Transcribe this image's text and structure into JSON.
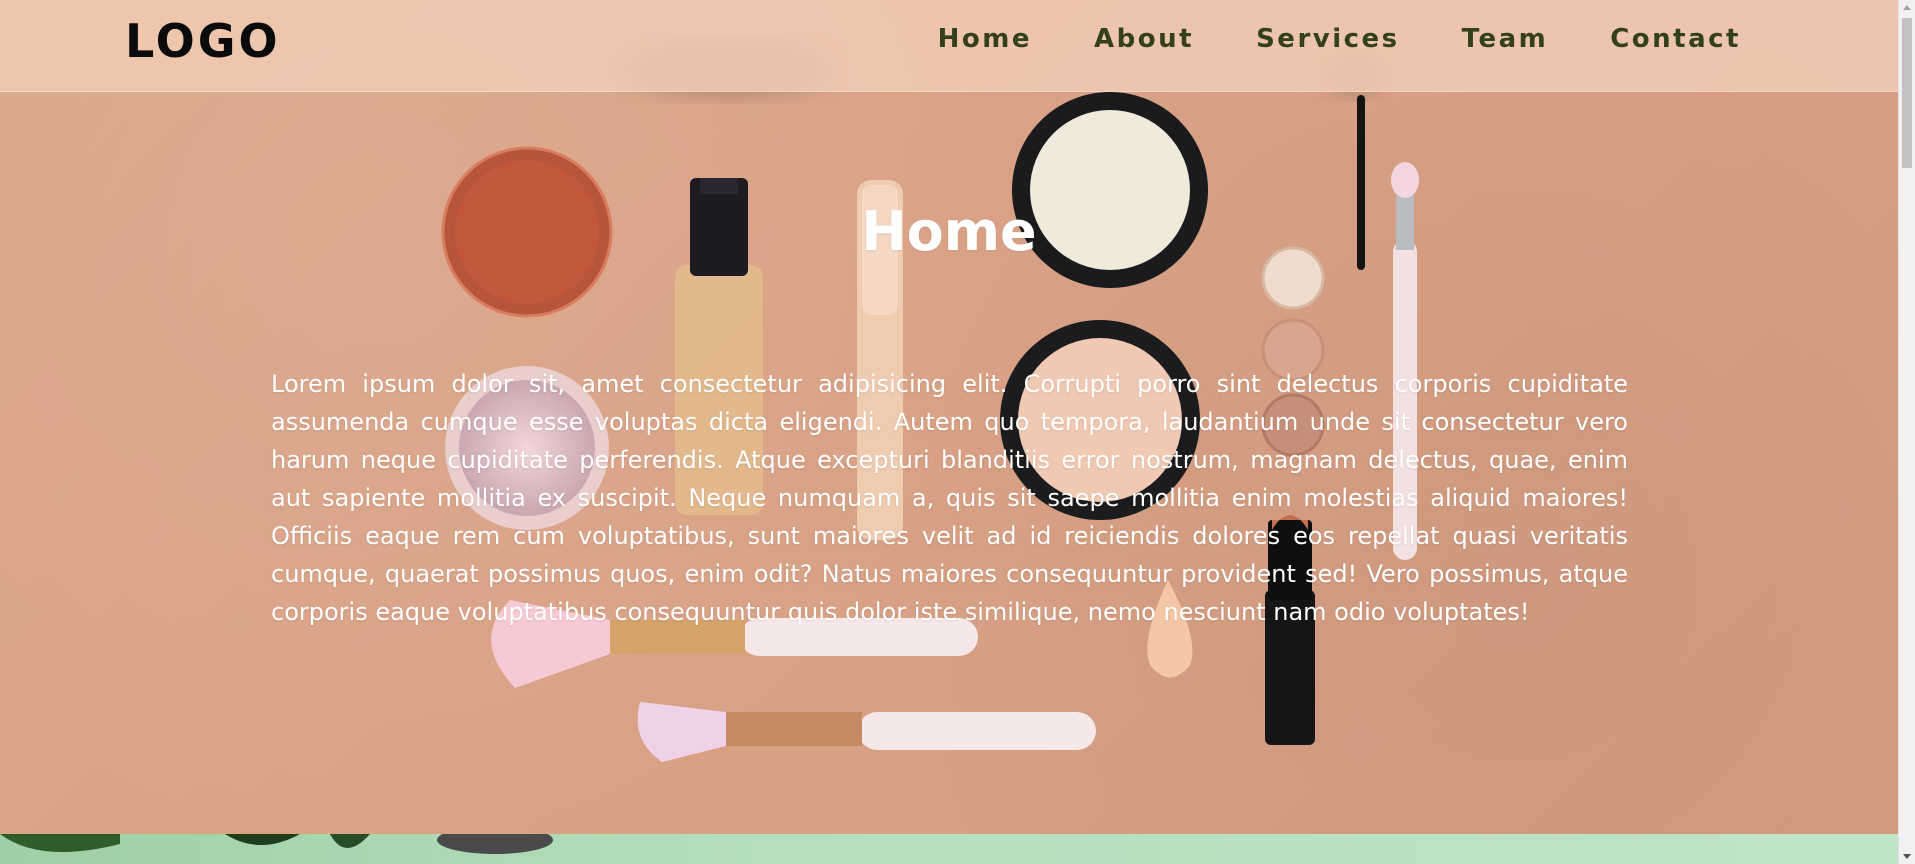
{
  "navbar": {
    "logo": "LOGO",
    "links": [
      "Home",
      "About",
      "Services",
      "Team",
      "Contact"
    ]
  },
  "hero": {
    "title": "Home",
    "paragraph": "Lorem ipsum dolor sit, amet consectetur adipisicing elit. Corrupti porro sint delectus corporis cupiditate assumenda cumque esse voluptas dicta eligendi. Autem quo tempora, laudantium unde sit consectetur vero harum neque cupiditate perferendis. Atque excepturi blanditiis error nostrum, magnam delectus, quae, enim aut sapiente mollitia ex suscipit. Neque numquam a, quis sit saepe mollitia enim molestias aliquid maiores! Officiis eaque rem cum voluptatibus, sunt maiores velit ad id reiciendis dolores eos repellat quasi veritatis cumque, quaerat possimus quos, enim odit? Natus maiores consequuntur provident sed! Vero possimus, atque corporis eaque voluptatibus consequuntur quis dolor iste similique, nemo nesciunt nam odio voluptates!",
    "background_image": "makeup-flatlay"
  },
  "colors": {
    "nav_bg": "#f2ccb6",
    "nav_text": "#33401e",
    "logo": "#0b0b0b",
    "hero_text": "#ffffff",
    "hero_bg": "#d9a286",
    "next_section": "#b5dfbd"
  }
}
